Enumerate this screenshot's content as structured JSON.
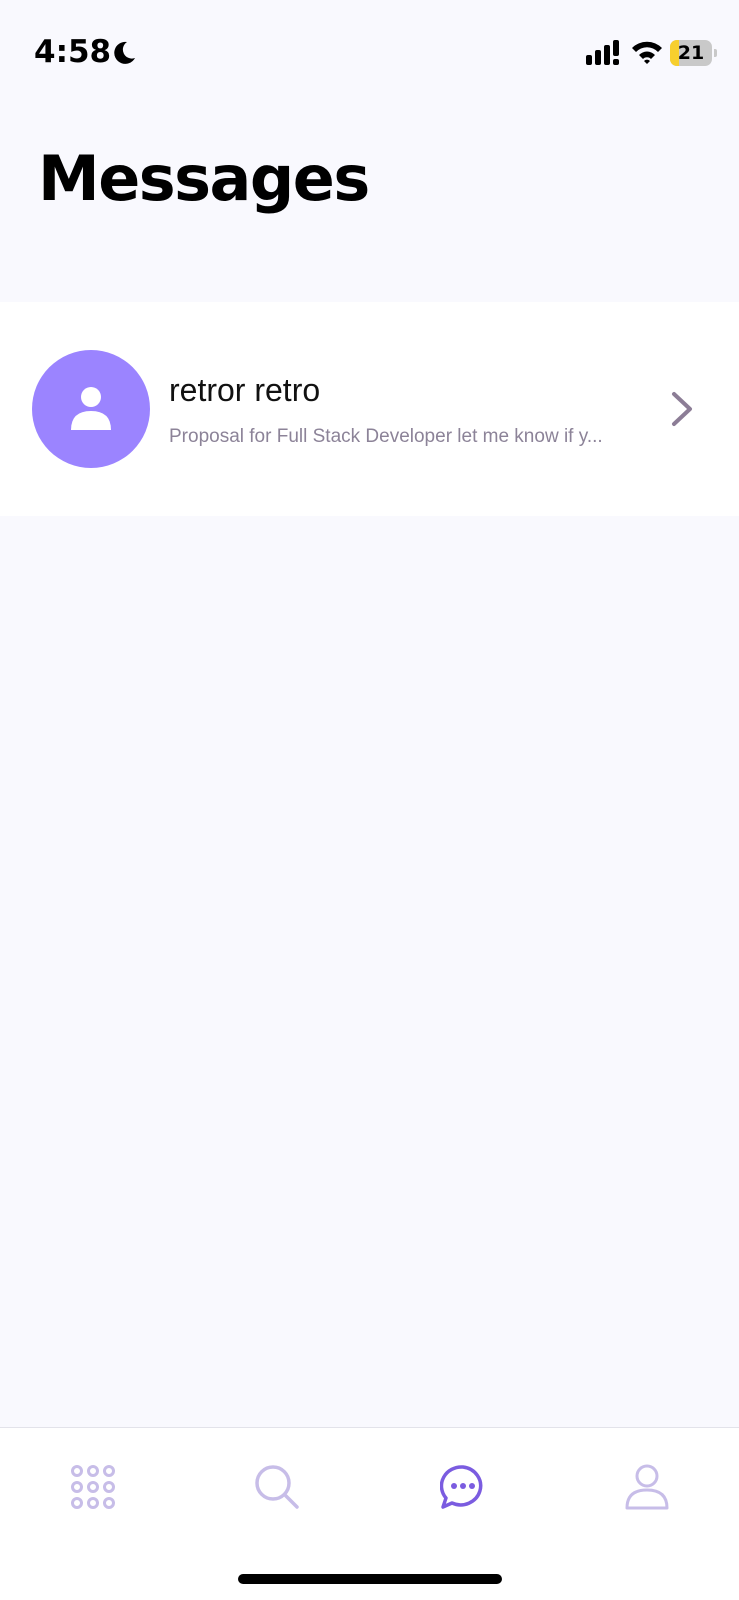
{
  "status_bar": {
    "time": "4:58",
    "battery_level": "21",
    "battery_fraction": 0.21,
    "icons": [
      "moon-icon",
      "cellular-signal-icon",
      "wifi-icon",
      "battery-icon"
    ]
  },
  "header": {
    "title": "Messages"
  },
  "conversations": [
    {
      "name": "retror retro",
      "preview": "Proposal for Full Stack Developer let me know if y...",
      "avatar_icon": "person-icon",
      "avatar_color": "#9b84ff"
    }
  ],
  "tab_bar": {
    "tabs": [
      {
        "icon": "grid-icon",
        "active": false
      },
      {
        "icon": "search-icon",
        "active": false
      },
      {
        "icon": "chat-bubble-icon",
        "active": true
      },
      {
        "icon": "person-icon",
        "active": false
      }
    ],
    "active_color": "#7b5ce0",
    "inactive_color": "#c7bde8"
  }
}
